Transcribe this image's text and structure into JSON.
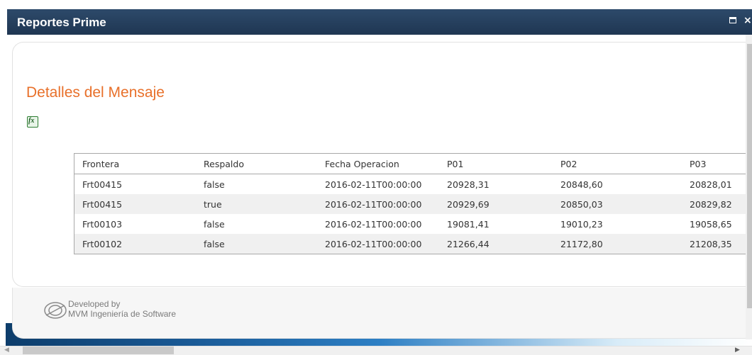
{
  "window": {
    "title": "Reportes Prime",
    "maximize_icon": "maximize-icon",
    "close_icon": "close-icon",
    "close_glyph": "×"
  },
  "main": {
    "section_title": "Detalles del Mensaje",
    "export_icon": "excel-export-icon",
    "export_glyph": "fx"
  },
  "table": {
    "columns": [
      "Frontera",
      "Respaldo",
      "Fecha Operacion",
      "P01",
      "P02",
      "P03"
    ],
    "rows": [
      [
        "Frt00415",
        "false",
        "2016-02-11T00:00:00",
        "20928,31",
        "20848,60",
        "20828,01"
      ],
      [
        "Frt00415",
        "true",
        "2016-02-11T00:00:00",
        "20929,69",
        "20850,03",
        "20829,82"
      ],
      [
        "Frt00103",
        "false",
        "2016-02-11T00:00:00",
        "19081,41",
        "19010,23",
        "19058,65"
      ],
      [
        "Frt00102",
        "false",
        "2016-02-11T00:00:00",
        "21266,44",
        "21172,80",
        "21208,35"
      ]
    ]
  },
  "footer": {
    "developed_by": "Developed by",
    "company": "MVM Ingeniería de Software",
    "logo_icon": "mvm-logo-icon"
  },
  "scrollbars": {
    "left_arrow": "◀",
    "right_arrow": "▶"
  },
  "colors": {
    "titlebar": "#253f5e",
    "accent_title": "#e8702a",
    "alt_row": "#f0f0f0"
  }
}
